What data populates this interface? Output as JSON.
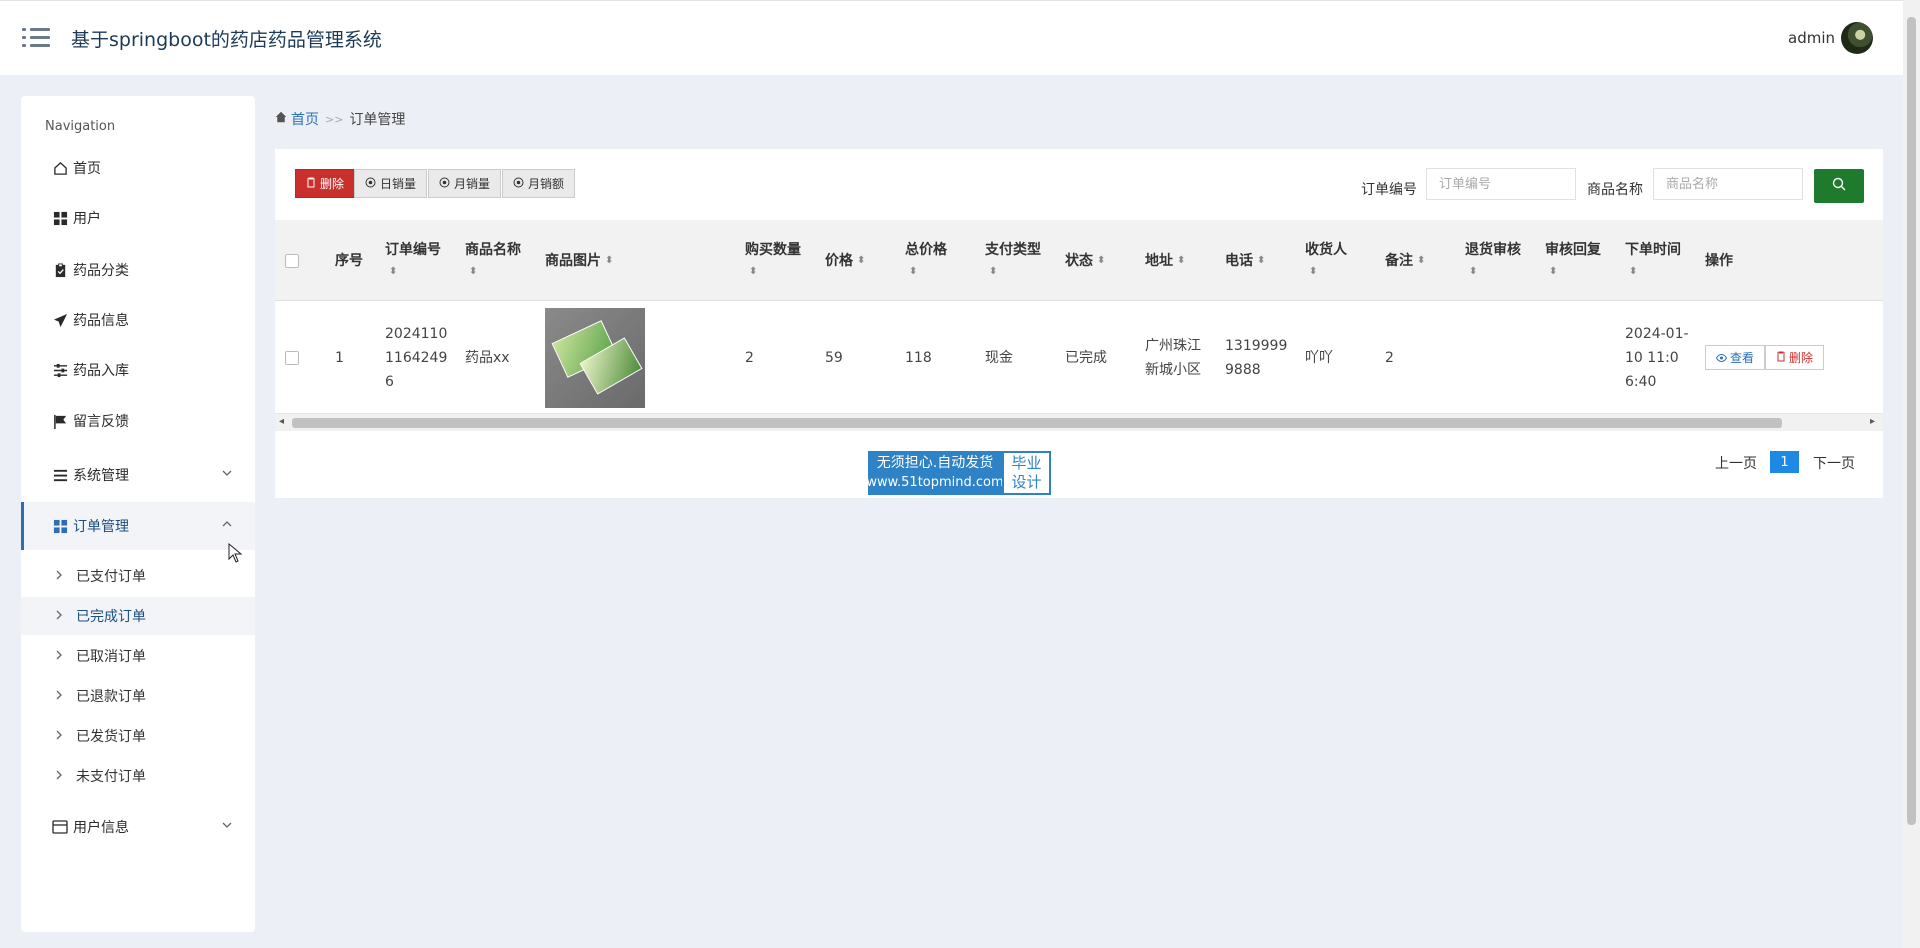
{
  "header": {
    "title": "基于springboot的药店药品管理系统",
    "user": "admin"
  },
  "sidebar": {
    "heading": "Navigation",
    "items": [
      {
        "label": "首页",
        "icon": "home-icon"
      },
      {
        "label": "用户",
        "icon": "grid-icon"
      },
      {
        "label": "药品分类",
        "icon": "clipboard-icon"
      },
      {
        "label": "药品信息",
        "icon": "send-icon"
      },
      {
        "label": "药品入库",
        "icon": "sliders-icon"
      },
      {
        "label": "留言反馈",
        "icon": "flag-icon"
      },
      {
        "label": "系统管理",
        "icon": "list-icon"
      },
      {
        "label": "订单管理",
        "icon": "dashboard-icon"
      },
      {
        "label": "用户信息",
        "icon": "card-icon"
      }
    ],
    "order_sub": [
      "已支付订单",
      "已完成订单",
      "已取消订单",
      "已退款订单",
      "已发货订单",
      "未支付订单"
    ]
  },
  "breadcrumb": {
    "home": "首页",
    "sep": ">>",
    "current": "订单管理"
  },
  "toolbar": {
    "delete": "删除",
    "daily": "日销量",
    "monthly": "月销量",
    "monthly_amount": "月销额"
  },
  "search": {
    "order_no_label": "订单编号",
    "order_no_placeholder": "订单编号",
    "product_label": "商品名称",
    "product_placeholder": "商品名称"
  },
  "table": {
    "headers": {
      "seq": "序号",
      "order_no": "订单编号",
      "product_name": "商品名称",
      "product_img": "商品图片",
      "qty": "购买数量",
      "price": "价格",
      "total": "总价格",
      "pay_type": "支付类型",
      "status": "状态",
      "address": "地址",
      "phone": "电话",
      "receiver": "收货人",
      "remark": "备注",
      "refund_review": "退货审核",
      "review_reply": "审核回复",
      "order_time": "下单时间",
      "actions": "操作"
    },
    "row": {
      "seq": "1",
      "order_no": "20241101164249 6",
      "product_name": "药品xx",
      "qty": "2",
      "price": "59",
      "total": "118",
      "pay_type": "现金",
      "status": "已完成",
      "address": "广州珠江新城小区",
      "phone": "13199999888",
      "receiver": "吖吖",
      "remark": "2",
      "refund_review": "",
      "review_reply": "",
      "order_time": "2024-01-10 11:06:40",
      "view": "查看",
      "delete": "删除"
    }
  },
  "watermark": {
    "line1": "无须担心.自动发货",
    "line2": "www.51topmind.com",
    "badge1": "毕业",
    "badge2": "设计"
  },
  "pager": {
    "prev": "上一页",
    "page": "1",
    "next": "下一页"
  },
  "colors": {
    "accent": "#2c6fb1",
    "danger": "#c9302c",
    "search": "#1e7a2c",
    "page": "#1e88e5"
  }
}
